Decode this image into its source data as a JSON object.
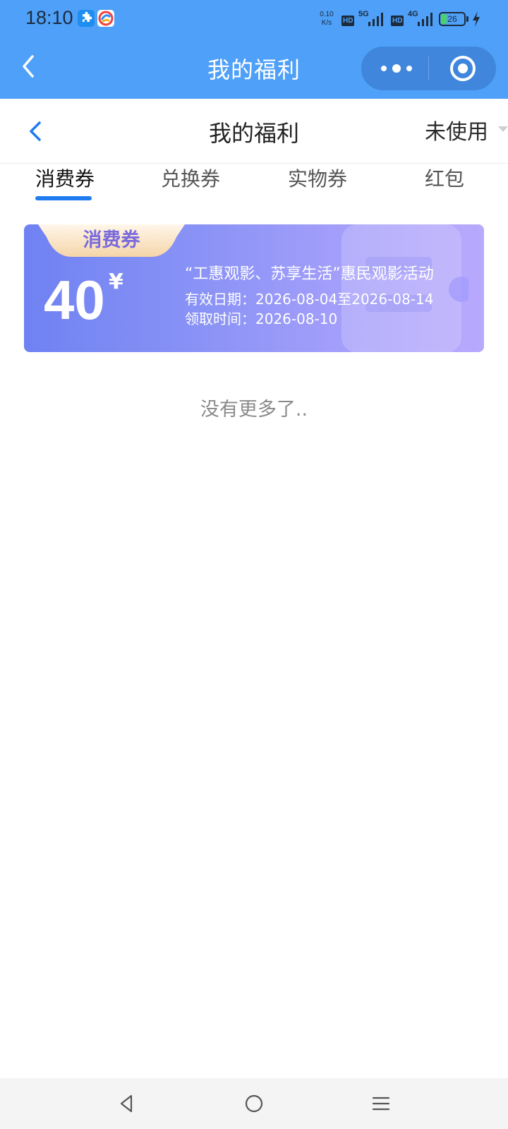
{
  "status_bar": {
    "time": "18:10",
    "net_speed_value": "0.10",
    "net_speed_unit": "K/s",
    "hd_label": "HD",
    "net1": "5G",
    "net2": "4G",
    "battery_level": 26,
    "battery_color": "#49d16a",
    "icons": [
      "app-puzzle-icon",
      "app-colorful-icon",
      "signal-icon",
      "charging-bolt-icon"
    ]
  },
  "nav_bar": {
    "title": "我的福利",
    "background": "#4ea0f8"
  },
  "header": {
    "title": "我的福利",
    "filter_value": "未使用"
  },
  "tabs": [
    {
      "label": "消费券",
      "active": true
    },
    {
      "label": "兑换券",
      "active": false
    },
    {
      "label": "实物券",
      "active": false
    },
    {
      "label": "红包",
      "active": false
    }
  ],
  "coupon": {
    "tag": "消费券",
    "amount": "40",
    "currency": "¥",
    "title": "“工惠观影、苏享生活”惠民观影活动",
    "valid_label": "有效日期：",
    "valid_range": "2026-08-04至2026-08-14",
    "claim_label": "领取时间：",
    "claim_date": "2026-08-10"
  },
  "list_end_text": "没有更多了..",
  "accent_color": "#1e7cf0"
}
